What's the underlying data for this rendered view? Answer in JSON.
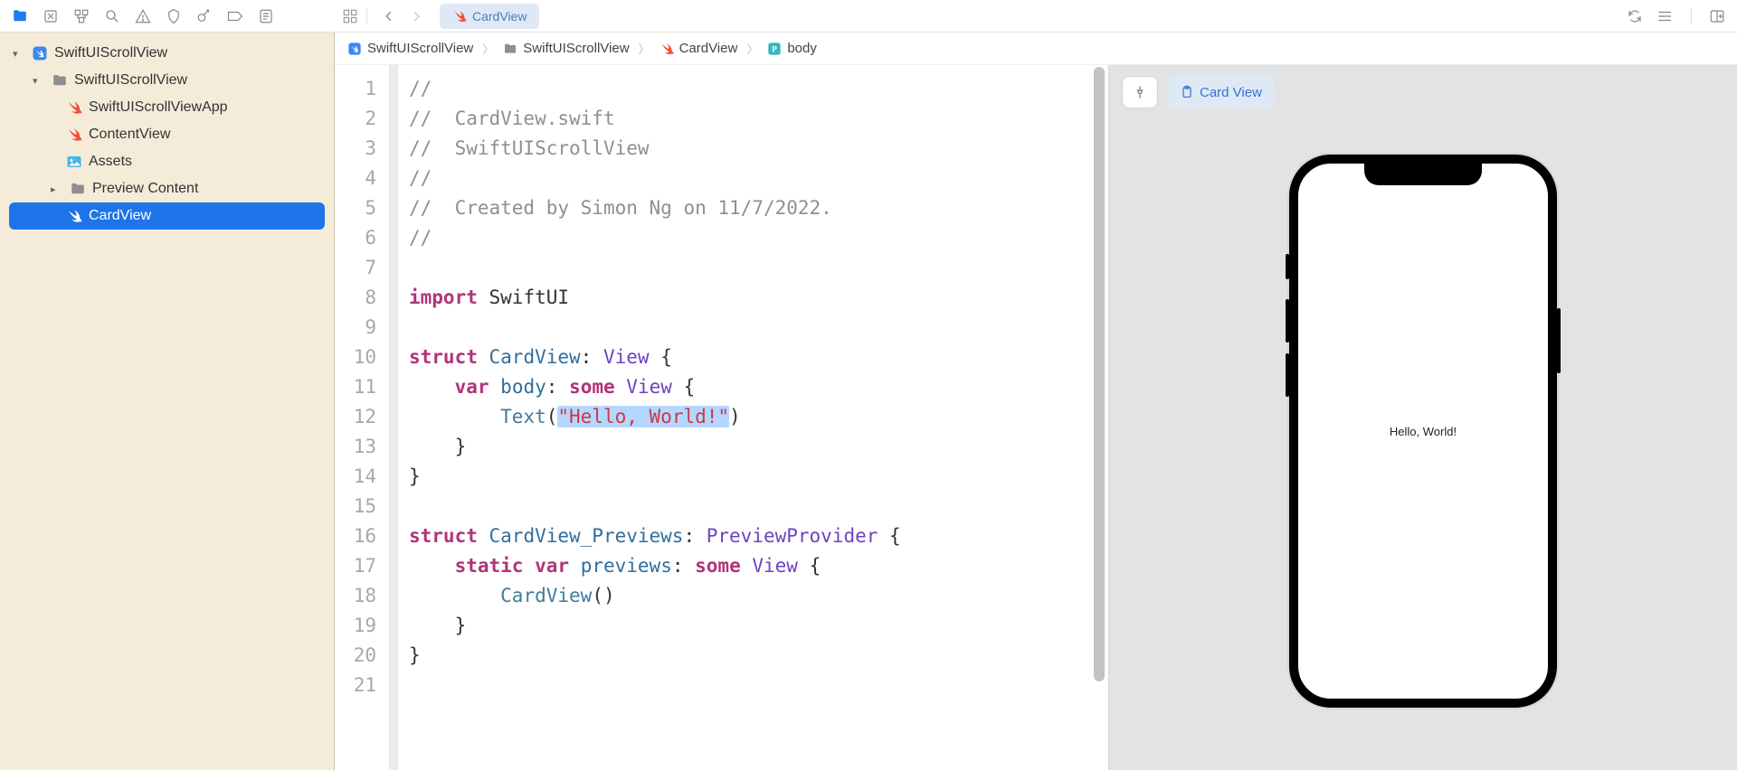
{
  "toolbar": {
    "tab_label": "CardView"
  },
  "navigator": {
    "root": "SwiftUIScrollView",
    "folder": "SwiftUIScrollView",
    "items": [
      {
        "name": "SwiftUIScrollViewApp",
        "icon": "swift"
      },
      {
        "name": "ContentView",
        "icon": "swift"
      },
      {
        "name": "Assets",
        "icon": "assets"
      }
    ],
    "preview_folder": "Preview Content",
    "selected": "CardView"
  },
  "breadcrumbs": {
    "a": "SwiftUIScrollView",
    "b": "SwiftUIScrollView",
    "c": "CardView",
    "d": "body"
  },
  "preview": {
    "chip": "Card View",
    "phone_text": "Hello, World!"
  },
  "code": {
    "file_comment_2": "CardView.swift",
    "file_comment_3": "SwiftUIScrollView",
    "file_comment_5": "Created by Simon Ng on 11/7/2022.",
    "import_kw": "import",
    "import_mod": "SwiftUI",
    "struct_kw": "struct",
    "struct_name": "CardView",
    "view_type": "View",
    "var_kw": "var",
    "body_name": "body",
    "some_kw": "some",
    "text_fn": "Text",
    "text_arg": "\"Hello, World!\"",
    "prev_struct": "CardView_Previews",
    "prev_type": "PreviewProvider",
    "static_kw": "static",
    "previews_name": "previews",
    "card_ctor": "CardView"
  },
  "line_numbers": [
    "1",
    "2",
    "3",
    "4",
    "5",
    "6",
    "7",
    "8",
    "9",
    "10",
    "11",
    "12",
    "13",
    "14",
    "15",
    "16",
    "17",
    "18",
    "19",
    "20",
    "21"
  ]
}
